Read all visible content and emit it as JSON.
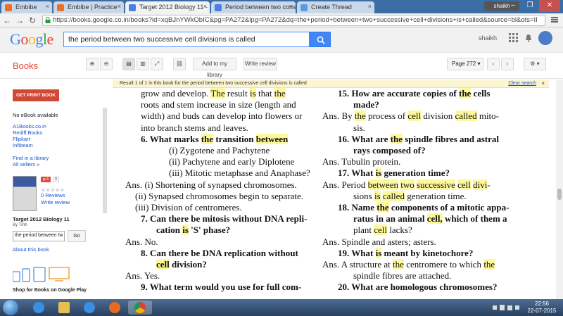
{
  "browser": {
    "tabs": [
      {
        "label": "Embibe",
        "active": false
      },
      {
        "label": "Embibe | Practice",
        "active": false
      },
      {
        "label": "Target 2012 Biology 11 -",
        "active": true
      },
      {
        "label": "Period between two consi",
        "active": false
      },
      {
        "label": "Create Thread",
        "active": false
      }
    ],
    "user_badge": "shaikh",
    "url": "https://books.google.co.in/books?id=xqBJnYWkObIC&pg=PA272&lpg=PA272&dq=the+period+between+two+successive+cell+divisions+is+called&source=bl&ots=II"
  },
  "google": {
    "logo": "Google",
    "search_value": "the period between two successive cell divisions is called",
    "user_name": "shaikh"
  },
  "books_bar": {
    "title": "Books",
    "add_library": "Add to my library",
    "write_review": "Write review",
    "page": "Page 272"
  },
  "result_strip": {
    "text": "Result 1 of 1 in this book for the period between two successive cell divisions is called",
    "clear": "Clear search"
  },
  "sidebar": {
    "print_button": "GET PRINT BOOK",
    "no_ebook": "No eBook available",
    "sellers": [
      "A1Books.co.in",
      "Rediff Books",
      "Flipkart",
      "Infibeam"
    ],
    "library": "Find in a library",
    "all_sellers": "All sellers »",
    "gplus": "g+1",
    "gcount": "0",
    "reviews": "0 Reviews",
    "write_review": "Write review",
    "book_title": "Target 2012 Biology 11",
    "author": "By Tmh",
    "search_value": "the period between tw",
    "go": "Go",
    "about": "About this book",
    "shop": "Shop for Books on Google Play"
  },
  "page": {
    "left": [
      {
        "t": "grow and develop. The result is that the"
      },
      {
        "t": "roots and stem increase in size (length and"
      },
      {
        "t": "width) and buds can develop into flowers or"
      },
      {
        "t": "into branch stems and leaves."
      },
      {
        "t": "6. What marks the transition between"
      },
      {
        "t": "(i) Zygotene and Pachytene"
      },
      {
        "t": "(ii) Pachytene and early Diplotene"
      },
      {
        "t": "(iii) Mitotic metaphase and Anaphase?"
      },
      {
        "t": "Ans. (i) Shortening of synapsed chromosomes."
      },
      {
        "t": "(ii) Synapsed chromosomes begin to separate."
      },
      {
        "t": "(iii) Division of centromeres."
      },
      {
        "t": "7. Can there be mitosis without DNA repli-"
      },
      {
        "t": "cation is 'S' phase?"
      },
      {
        "t": "Ans. No."
      },
      {
        "t": "8. Can there be DNA replication without"
      },
      {
        "t": "cell division?"
      },
      {
        "t": "Ans. Yes."
      },
      {
        "t": "9. What term would you use for full com-"
      }
    ],
    "right": [
      {
        "t": "15. How are accurate copies of the cells"
      },
      {
        "t": "made?"
      },
      {
        "t": "Ans. By the process of cell division called mito-"
      },
      {
        "t": "sis."
      },
      {
        "t": "16. What are the spindle fibres and astral"
      },
      {
        "t": "rays composed of?"
      },
      {
        "t": "Ans. Tubulin protein."
      },
      {
        "t": "17. What is generation time?"
      },
      {
        "t": "Ans. Period between two successive cell divi-"
      },
      {
        "t": "sions is called generation time."
      },
      {
        "t": "18. Name the components of a mitotic appa-"
      },
      {
        "t": "ratus in an animal cell, which of them a"
      },
      {
        "t": "plant cell lacks?"
      },
      {
        "t": "Ans. Spindle and asters; asters."
      },
      {
        "t": "19. What is meant by kinetochore?"
      },
      {
        "t": "Ans. A structure at the centromere to which the"
      },
      {
        "t": "spindle fibres are attached."
      },
      {
        "t": "20. What are homologous chromosomes?"
      }
    ]
  },
  "taskbar": {
    "time": "22:56",
    "date": "22-07-2015"
  },
  "colors": {
    "highlight": "#fdf89b",
    "google_blue": "#4285f4",
    "books_red": "#dd4b39"
  }
}
